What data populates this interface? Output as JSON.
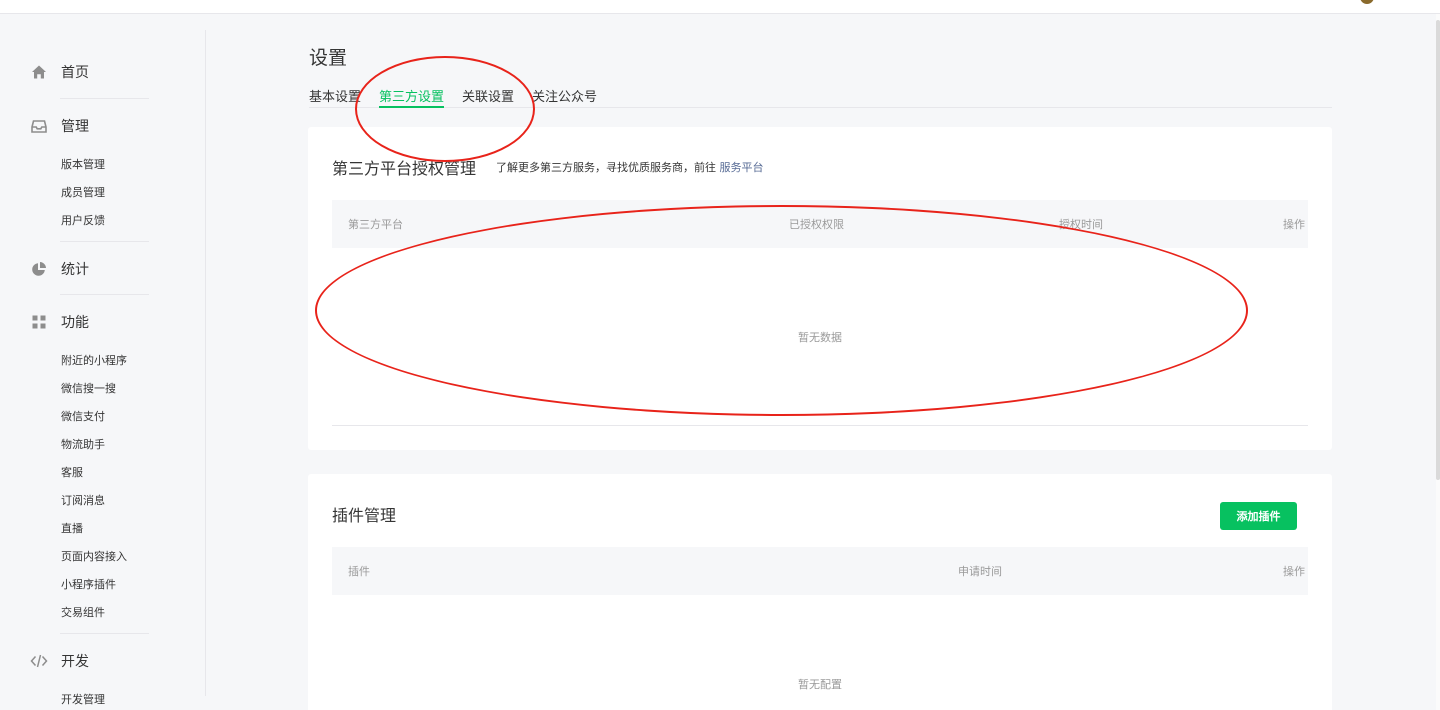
{
  "sidebar": {
    "home": {
      "label": "首页",
      "icon": "home-icon"
    },
    "manage": {
      "label": "管理",
      "icon": "inbox-icon",
      "items": [
        "版本管理",
        "成员管理",
        "用户反馈"
      ]
    },
    "stats": {
      "label": "统计",
      "icon": "pie-chart-icon"
    },
    "features": {
      "label": "功能",
      "icon": "grid-icon",
      "items": [
        "附近的小程序",
        "微信搜一搜",
        "微信支付",
        "物流助手",
        "客服",
        "订阅消息",
        "直播",
        "页面内容接入",
        "小程序插件",
        "交易组件"
      ]
    },
    "dev": {
      "label": "开发",
      "icon": "code-icon",
      "items": [
        "开发管理"
      ]
    }
  },
  "page": {
    "title": "设置"
  },
  "tabs": [
    {
      "label": "基本设置",
      "active": false
    },
    {
      "label": "第三方设置",
      "active": true
    },
    {
      "label": "关联设置",
      "active": false
    },
    {
      "label": "关注公众号",
      "active": false
    }
  ],
  "third_party": {
    "title": "第三方平台授权管理",
    "desc": "了解更多第三方服务，寻找优质服务商，前往",
    "link": "服务平台",
    "columns": [
      "第三方平台",
      "已授权权限",
      "授权时间",
      "操作"
    ],
    "empty": "暂无数据"
  },
  "plugins": {
    "title": "插件管理",
    "add_button": "添加插件",
    "columns": [
      "插件",
      "申请时间",
      "操作"
    ],
    "empty": "暂无配置"
  },
  "colors": {
    "accent": "#07c160",
    "link": "#576b95",
    "annotation": "#e8231a"
  }
}
